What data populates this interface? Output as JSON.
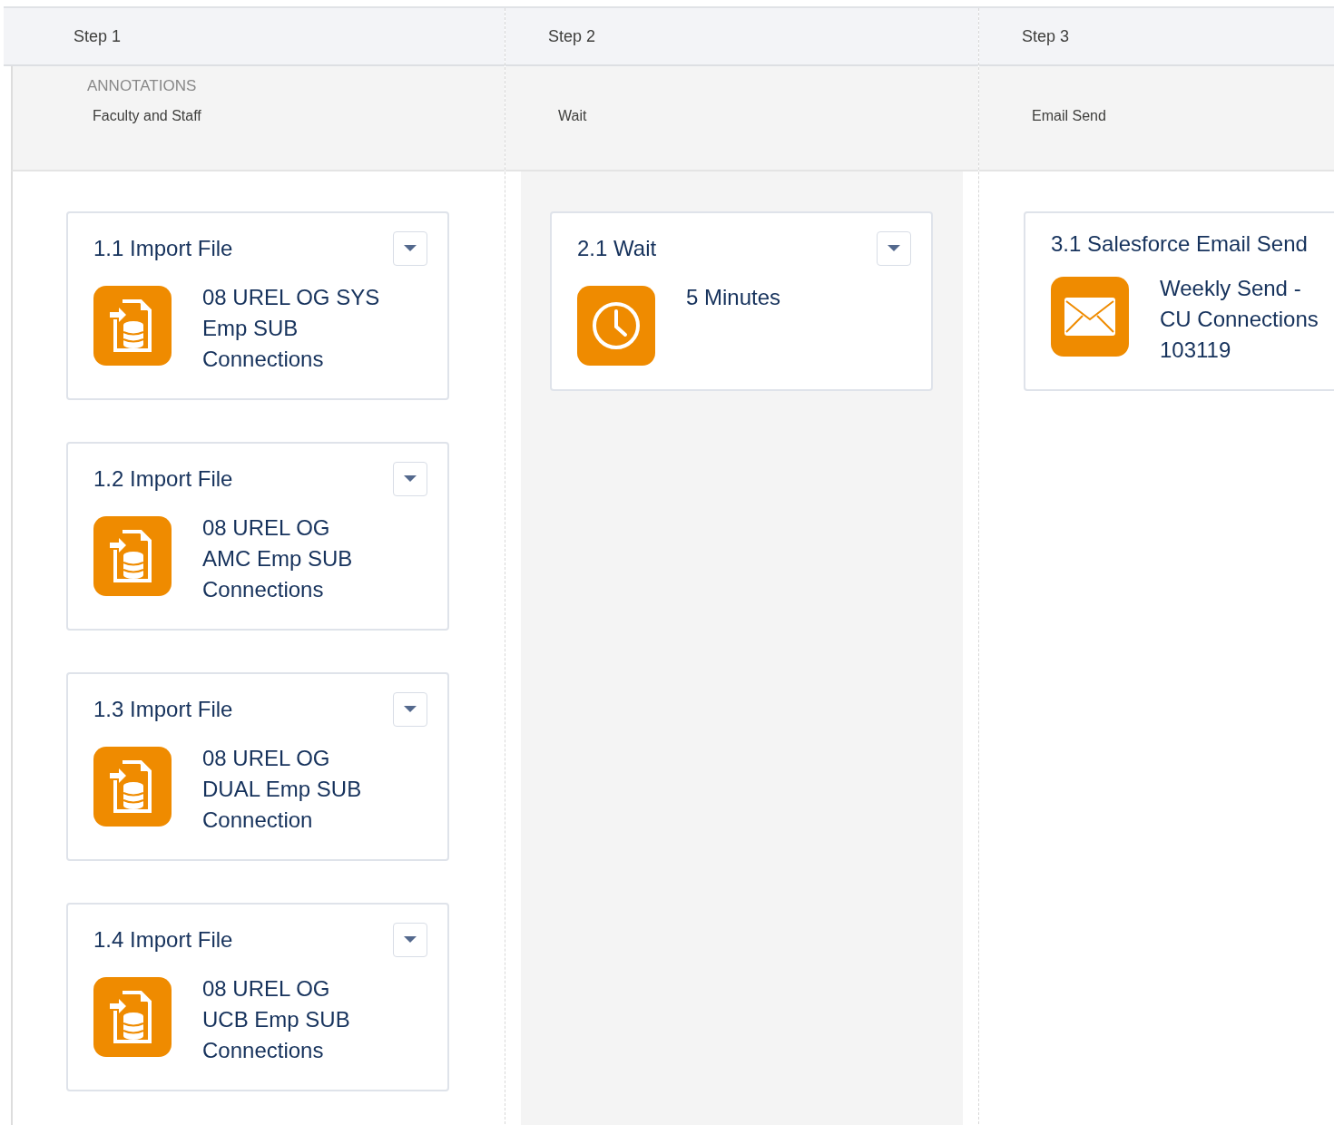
{
  "columns": [
    {
      "step": "Step 1",
      "annotation_heading": "ANNOTATIONS",
      "annotation": "Faculty and Staff",
      "highlighted": false,
      "cards": [
        {
          "title": "1.1 Import File",
          "kind": "import",
          "lines": [
            "08 UREL OG SYS",
            "Emp SUB",
            "Connections"
          ]
        },
        {
          "title": "1.2 Import File",
          "kind": "import",
          "lines": [
            "08 UREL OG",
            "AMC Emp SUB",
            "Connections"
          ]
        },
        {
          "title": "1.3 Import File",
          "kind": "import",
          "lines": [
            "08 UREL OG",
            "DUAL Emp SUB",
            "Connection"
          ]
        },
        {
          "title": "1.4 Import File",
          "kind": "import",
          "lines": [
            "08 UREL OG",
            "UCB Emp SUB",
            "Connections"
          ]
        }
      ]
    },
    {
      "step": "Step 2",
      "annotation": "Wait",
      "highlighted": true,
      "cards": [
        {
          "title": "2.1 Wait",
          "kind": "wait",
          "lines": [
            "5 Minutes"
          ]
        }
      ]
    },
    {
      "step": "Step 3",
      "annotation": "Email Send",
      "highlighted": false,
      "cards": [
        {
          "title": "3.1 Salesforce Email Send",
          "kind": "email",
          "menu_button": false,
          "lines": [
            "Weekly Send -",
            "CU Connections",
            "103119"
          ]
        }
      ]
    }
  ]
}
